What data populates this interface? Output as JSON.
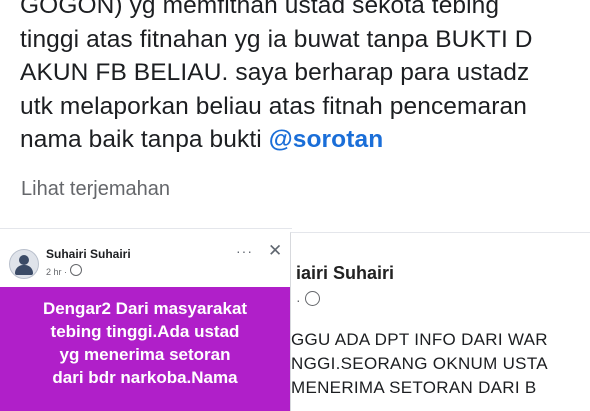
{
  "post": {
    "lines": [
      "GOGON) yg memfitnah ustad sekota tebing",
      "tinggi atas fitnahan yg ia buwat tanpa BUKTI D",
      "AKUN FB BELIAU. saya berharap para ustadz",
      "utk melaporkan beliau atas fitnah pencemaran",
      "nama baik tanpa bukti "
    ],
    "mention": "@sorotan",
    "translate_label": "Lihat terjemahan"
  },
  "left_card": {
    "author": "Suhairi Suhairi",
    "meta": "2 hr · ",
    "more_glyph": "···",
    "close_glyph": "✕",
    "purple_lines": [
      "Dengar2 Dari masyarakat",
      "tebing tinggi.Ada ustad",
      "yg menerima setoran",
      "dari bdr narkoba.Nama"
    ],
    "background_color": "#b01fc9"
  },
  "right_card": {
    "author": "iairi Suhairi",
    "meta": "· ",
    "lines": [
      "GGU ADA DPT INFO DARI WAR",
      "NGGI.SEORANG OKNUM USTA",
      "MENERIMA SETORAN DARI B"
    ]
  },
  "colors": {
    "mention": "#1a6ed8",
    "secondary_text": "#65676b"
  }
}
